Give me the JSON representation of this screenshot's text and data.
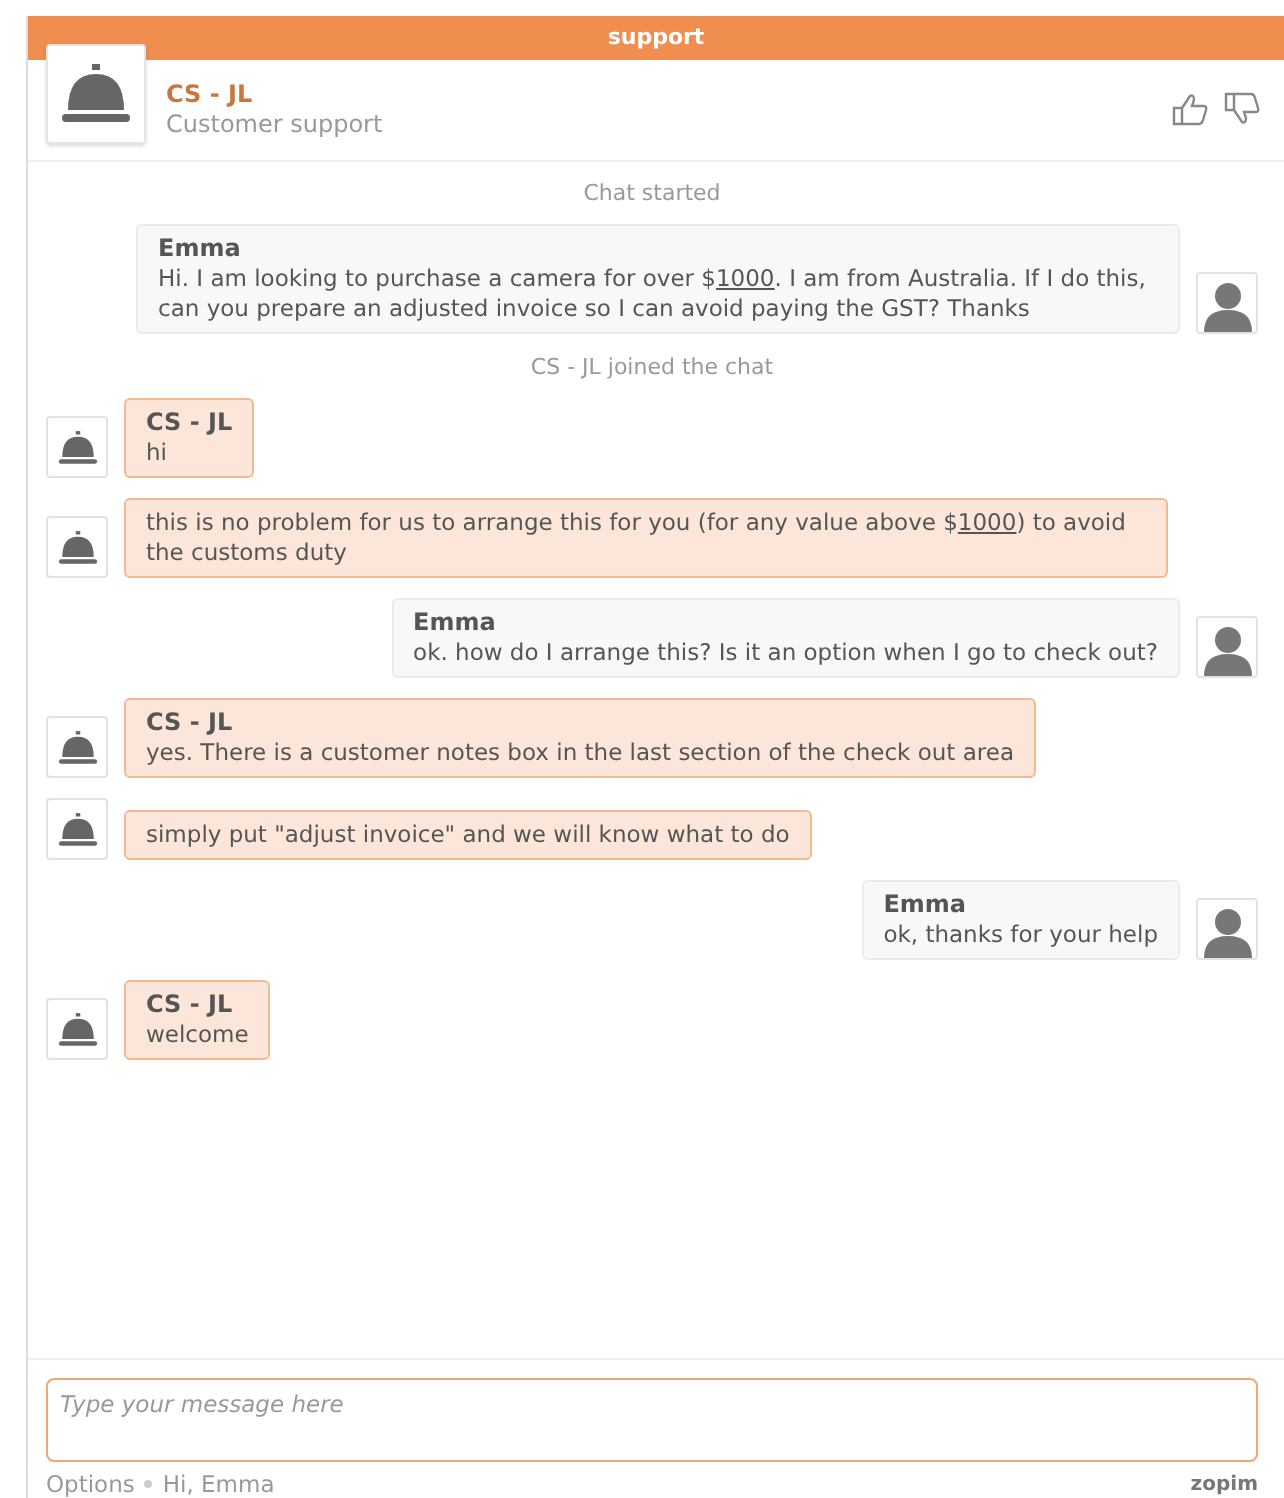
{
  "window": {
    "title": "support"
  },
  "header": {
    "name": "CS - JL",
    "subtitle": "Customer support"
  },
  "messages": [
    {
      "kind": "event",
      "text": "Chat started"
    },
    {
      "kind": "visitor",
      "name": "Emma",
      "parts": [
        {
          "kind": "text",
          "text": "Hi. I am looking to purchase a camera for over $"
        },
        {
          "kind": "link",
          "text": "1000"
        },
        {
          "kind": "text",
          "text": ". I am from Australia. If I do this, can you prepare an adjusted invoice so I can avoid paying the GST? Thanks"
        }
      ]
    },
    {
      "kind": "event",
      "text": "CS - JL joined the chat"
    },
    {
      "kind": "agent",
      "name": "CS - JL",
      "parts": [
        {
          "kind": "text",
          "text": "hi"
        }
      ]
    },
    {
      "kind": "agent",
      "parts": [
        {
          "kind": "text",
          "text": "this is no problem for us to arrange this for you (for any value above $"
        },
        {
          "kind": "link",
          "text": "1000"
        },
        {
          "kind": "text",
          "text": ") to avoid the customs duty"
        }
      ]
    },
    {
      "kind": "visitor",
      "name": "Emma",
      "parts": [
        {
          "kind": "text",
          "text": "ok. how do I arrange this? Is it an option when I go to check out?"
        }
      ]
    },
    {
      "kind": "agent",
      "name": "CS - JL",
      "parts": [
        {
          "kind": "text",
          "text": "yes. There is a customer notes box in the last section of the check out area"
        }
      ]
    },
    {
      "kind": "agent",
      "parts": [
        {
          "kind": "text",
          "text": "simply put \"adjust invoice\" and we will know what to do"
        }
      ]
    },
    {
      "kind": "visitor",
      "name": "Emma",
      "parts": [
        {
          "kind": "text",
          "text": "ok, thanks for your help"
        }
      ]
    },
    {
      "kind": "agent",
      "name": "CS - JL",
      "parts": [
        {
          "kind": "text",
          "text": "welcome"
        }
      ]
    }
  ],
  "composer": {
    "placeholder": "Type your message here"
  },
  "footer": {
    "options": "Options",
    "greeting": "Hi, Emma",
    "brand": "zopim"
  }
}
